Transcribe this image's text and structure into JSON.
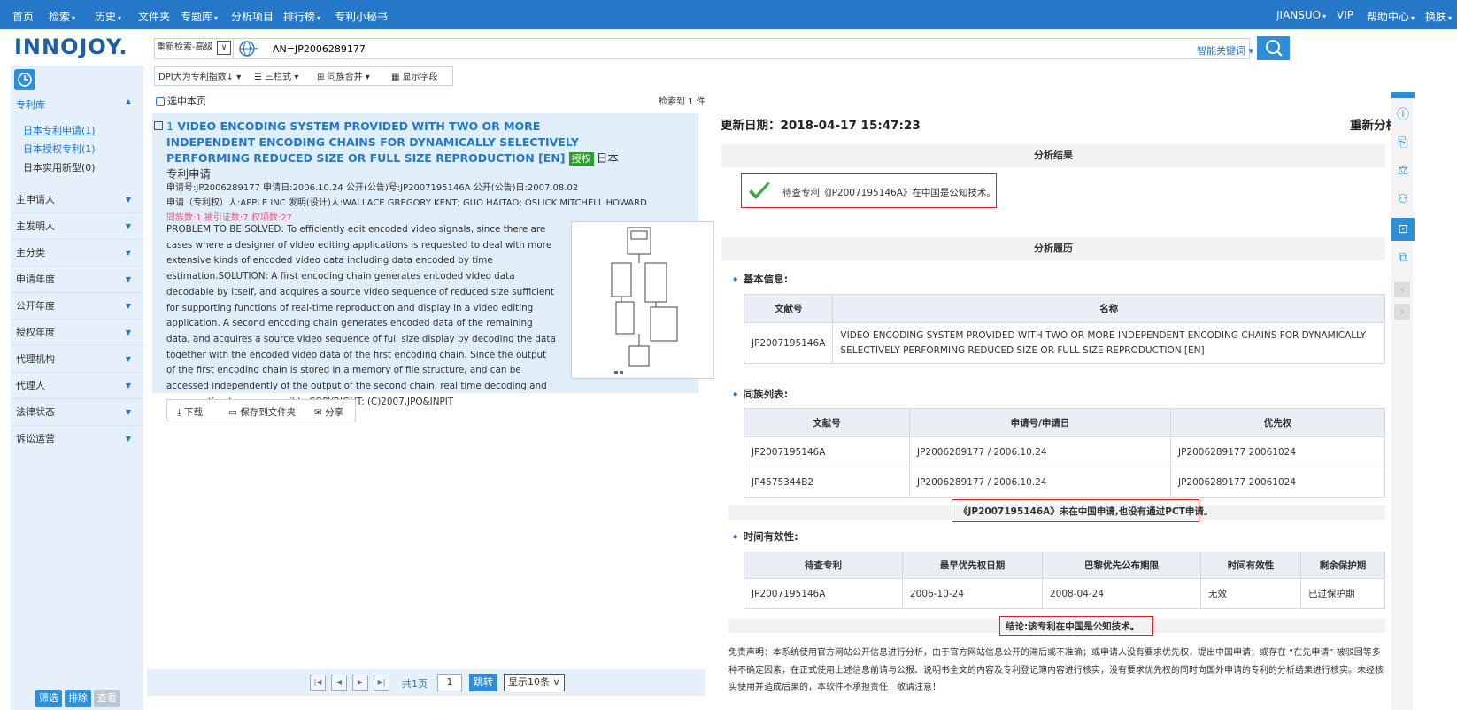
{
  "nav": {
    "home": "首页",
    "search": "检索",
    "history": "历史",
    "folders": "文件夹",
    "topic_lib": "专题库",
    "analysis": "分析项目",
    "ranking": "排行榜",
    "secretary": "专利小秘书",
    "account": "JIANSUO",
    "vip": "VIP",
    "help": "帮助中心",
    "skin": "换肤"
  },
  "logo": "INNOJOY.",
  "search": {
    "mode": "重新检索-高级",
    "mode_caret": "∨",
    "query": "AN=JP2006289177",
    "smart_kw": "智能关键词",
    "button_icon": "search-icon"
  },
  "toolbar": {
    "sort": "DPI大为专利指数↓",
    "columns": "三栏式",
    "family_merge": "同族合并",
    "display_fields": "显示字段"
  },
  "results": {
    "select_page": "选中本页",
    "found": "检索到 1 件",
    "index": "1",
    "title": "VIDEO ENCODING SYSTEM PROVIDED WITH TWO OR MORE INDEPENDENT ENCODING CHAINS FOR DYNAMICALLY SELECTIVELY PERFORMING REDUCED SIZE OR FULL SIZE REPRODUCTION [EN]",
    "badge": "授权",
    "type": "日本专利申请",
    "meta1": "申请号:JP2006289177   申请日:2006.10.24   公开(公告)号:JP2007195146A   公开(公告)日:2007.08.02",
    "meta2": "申请（专利权）人:APPLE INC   发明(设计)人:WALLACE GREGORY KENT; GUO HAITAO; OSLICK MITCHELL HOWARD",
    "counts": "同族数:1   被引证数:7   权项数:27",
    "abstract": "PROBLEM TO BE SOLVED: To efficiently edit encoded video signals, since there are cases where a designer of video editing applications is requested to deal with more extensive kinds of encoded video data including data encoded by time estimation.SOLUTION: A first encoding chain generates encoded video data decodable by itself, and acquires a source video sequence of reduced size sufficient for supporting functions of real-time reproduction and display in a video editing application. A second encoding chain generates encoded data of the remaining data, and acquires a source video sequence of full size display by decoding the data together with the encoded video data of the first encoding chain. Since the output of the first encoding chain is stored in a memory of file structure, and can be accessed independently of the output of the second chain, real time decoding and regeneration become possible.COPYRIGHT: (C)2007,JPO&INPIT",
    "download": "下载",
    "save_folder": "保存到文件夹",
    "share": "分享"
  },
  "sidebar": {
    "lib": "专利库",
    "sub": [
      "日本专利申请(1)",
      "日本授权专利(1)",
      "日本实用新型(0)"
    ],
    "rows": [
      "主申请人",
      "主发明人",
      "主分类",
      "申请年度",
      "公开年度",
      "授权年度",
      "代理机构",
      "代理人",
      "法律状态",
      "诉讼运营"
    ],
    "filter": "筛选",
    "exclude": "排除",
    "view": "查看"
  },
  "pager": {
    "total": "共1页",
    "page": "1",
    "goto": "跳转",
    "per_page": "显示10条"
  },
  "analysis": {
    "update": "更新日期：2018-04-17 15:47:23",
    "reanalyze": "重新分析",
    "result_band": "分析结果",
    "result_text": "待查专利《JP2007195146A》在中国是公知技术。",
    "history_band": "分析履历",
    "basic_title": "基本信息:",
    "basic_head": [
      "文献号",
      "名称"
    ],
    "basic_row": [
      "JP2007195146A",
      "VIDEO ENCODING SYSTEM PROVIDED WITH TWO OR MORE INDEPENDENT ENCODING CHAINS FOR DYNAMICALLY SELECTIVELY PERFORMING REDUCED SIZE OR FULL SIZE REPRODUCTION [EN]"
    ],
    "family_title": "同族列表:",
    "family_head": [
      "文献号",
      "申请号/申请日",
      "优先权"
    ],
    "family_rows": [
      [
        "JP2007195146A",
        "JP2006289177 / 2006.10.24",
        "JP2006289177 20061024"
      ],
      [
        "JP4575344B2",
        "JP2006289177 / 2006.10.24",
        "JP2006289177 20061024"
      ]
    ],
    "family_note": "《JP2007195146A》未在中国申请,也没有通过PCT申请。",
    "time_title": "时间有效性:",
    "time_head": [
      "待查专利",
      "最早优先权日期",
      "巴黎优先公布期限",
      "时间有效性",
      "剩余保护期"
    ],
    "time_row": [
      "JP2007195146A",
      "2006-10-24",
      "2008-04-24",
      "无效",
      "已过保护期"
    ],
    "conclusion": "结论:该专利在中国是公知技术。",
    "disclaimer": "免责声明：本系统使用官方网站公开信息进行分析，由于官方网站信息公开的滞后或不准确；或申请人没有要求优先权，提出中国申请；或存在 “在先申请” 被驳回等多种不确定因素，在正式使用上述信息前请与公报、说明书全文的内容及专利登记簿内容进行核实，没有要求优先权的同时向国外申请的专利的分析结果进行核实。未经核实使用并造成后果的，本软件不承担责任！敬请注意！"
  },
  "colors": {
    "nav_bg": "#2577c7",
    "accent": "#2e8fd8",
    "sidebar_bg": "#e6f0fa",
    "highlight_red": "#e0201c",
    "badge_green": "#2d9d2d"
  }
}
